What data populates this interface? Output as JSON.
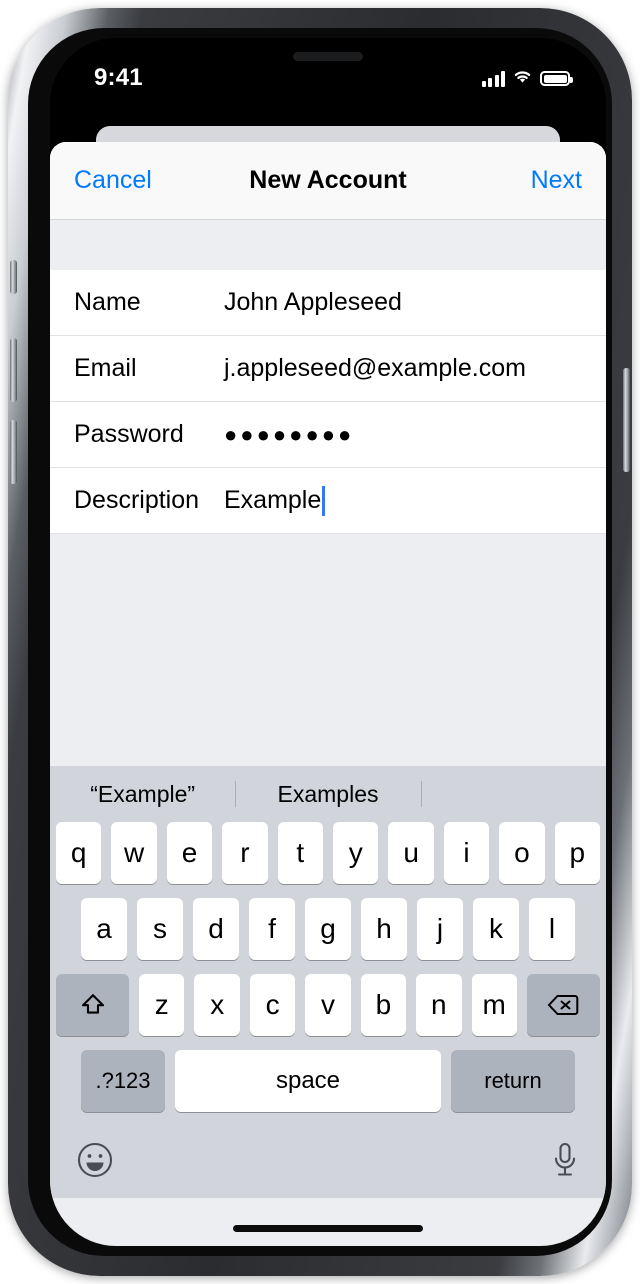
{
  "status_bar": {
    "time": "9:41",
    "signal_icon": "cellular-signal-icon",
    "wifi_icon": "wifi-icon",
    "battery_icon": "battery-icon"
  },
  "nav": {
    "cancel_label": "Cancel",
    "title": "New Account",
    "next_label": "Next"
  },
  "form": {
    "rows": [
      {
        "label": "Name",
        "value": "John Appleseed",
        "type": "text"
      },
      {
        "label": "Email",
        "value": "j.appleseed@example.com",
        "type": "email"
      },
      {
        "label": "Password",
        "value": "●●●●●●●●",
        "type": "password"
      },
      {
        "label": "Description",
        "value": "Example",
        "type": "text",
        "focused": true
      }
    ]
  },
  "keyboard": {
    "suggestions": [
      "“Example”",
      "Examples",
      ""
    ],
    "row1": [
      "q",
      "w",
      "e",
      "r",
      "t",
      "y",
      "u",
      "i",
      "o",
      "p"
    ],
    "row2": [
      "a",
      "s",
      "d",
      "f",
      "g",
      "h",
      "j",
      "k",
      "l"
    ],
    "row3": [
      "z",
      "x",
      "c",
      "v",
      "b",
      "n",
      "m"
    ],
    "shift_icon": "shift-icon",
    "backspace_icon": "backspace-icon",
    "numeric_label": ".?123",
    "space_label": "space",
    "return_label": "return",
    "emoji_icon": "emoji-icon",
    "microphone_icon": "microphone-icon"
  },
  "colors": {
    "accent_blue": "#007aff",
    "caret_blue": "#3478f6",
    "keyboard_bg": "#d1d4da",
    "key_white": "#ffffff",
    "key_gray": "#adb3bd",
    "form_bg": "#eceef2"
  }
}
